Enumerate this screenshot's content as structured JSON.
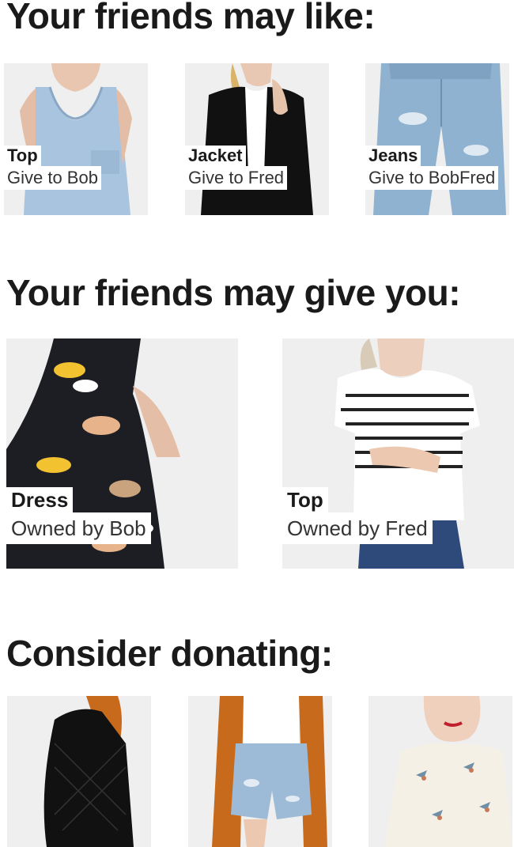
{
  "sections": {
    "like": {
      "title": "Your friends may like:",
      "items": [
        {
          "name": "Top",
          "sub": "Give to Bob",
          "image_icon": "tank-top-photo"
        },
        {
          "name": "Jacket",
          "sub": "Give to Fred",
          "image_icon": "black-blazer-photo"
        },
        {
          "name": "Jeans",
          "sub": "Give to BobFred",
          "image_icon": "ripped-jeans-photo"
        }
      ]
    },
    "give": {
      "title": "Your friends may give you:",
      "items": [
        {
          "name": "Dress",
          "sub": "Owned by Bob",
          "image_icon": "floral-dress-photo"
        },
        {
          "name": "Top",
          "sub": "Owned by Fred",
          "image_icon": "striped-tee-photo"
        }
      ]
    },
    "donate": {
      "title": "Consider donating:",
      "items": [
        {
          "image_icon": "leather-jacket-photo"
        },
        {
          "image_icon": "denim-shorts-photo"
        },
        {
          "image_icon": "bird-print-blouse-photo"
        }
      ]
    }
  },
  "colors": {
    "text": "#1a1a1a",
    "tile_bg": "#efefef",
    "denim": "#8fb2d0",
    "black": "#111111",
    "orange": "#c76a1c",
    "yellow": "#f2c230"
  }
}
